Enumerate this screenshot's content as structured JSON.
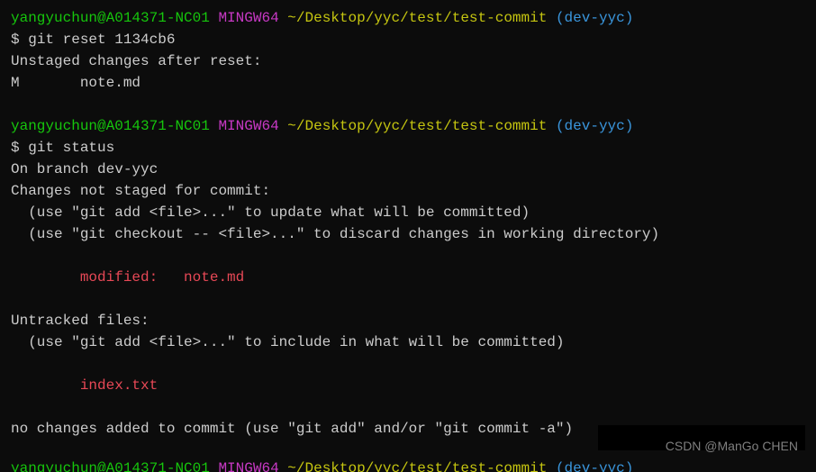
{
  "prompt": {
    "user": "yangyuchun",
    "host": "A014371-NC01",
    "shell": "MINGW64",
    "path": "~/Desktop/yyc/test/test-commit",
    "branch": "(dev-yyc)",
    "symbol": "$"
  },
  "block1": {
    "command": "git reset 1134cb6",
    "msg": "Unstaged changes after reset:",
    "fileStatus": "M       note.md"
  },
  "block2": {
    "command": "git status",
    "l1": "On branch dev-yyc",
    "l2": "Changes not staged for commit:",
    "l3": "  (use \"git add <file>...\" to update what will be committed)",
    "l4": "  (use \"git checkout -- <file>...\" to discard changes in working directory)",
    "modified": "        modified:   note.md",
    "l5": "Untracked files:",
    "l6": "  (use \"git add <file>...\" to include in what will be committed)",
    "untracked": "        index.txt",
    "l7": "no changes added to commit (use \"git add\" and/or \"git commit -a\")"
  },
  "watermark": "CSDN @ManGo CHEN"
}
